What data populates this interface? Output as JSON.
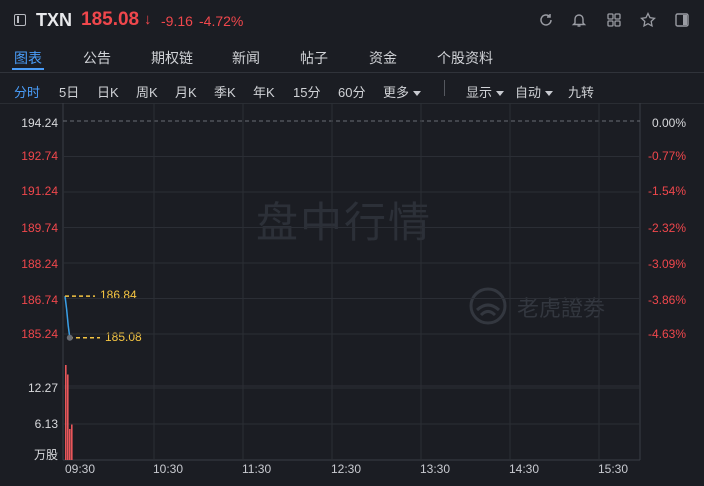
{
  "header": {
    "ticker": "TXN",
    "price": "185.08",
    "price_arrow": "↓",
    "change": "-9.16",
    "change_pct": "-4.72%",
    "icons": [
      "sidebar-toggle-icon",
      "refresh-icon",
      "bell-icon",
      "grid-icon",
      "star-icon",
      "panel-icon"
    ]
  },
  "tabs": [
    {
      "label": "图表",
      "active": true
    },
    {
      "label": "公告"
    },
    {
      "label": "期权链"
    },
    {
      "label": "新闻"
    },
    {
      "label": "帖子"
    },
    {
      "label": "资金"
    },
    {
      "label": "个股资料"
    }
  ],
  "periods": [
    {
      "label": "分时",
      "active": true
    },
    {
      "label": "5日"
    },
    {
      "label": "日K"
    },
    {
      "label": "周K"
    },
    {
      "label": "月K"
    },
    {
      "label": "季K"
    },
    {
      "label": "年K"
    },
    {
      "label": "15分"
    },
    {
      "label": "60分"
    },
    {
      "label": "更多"
    }
  ],
  "controls": [
    "显示",
    "自动",
    "九转"
  ],
  "watermark": "盘中行情",
  "brand": "老虎證劵",
  "colors": {
    "background": "#1b1d23",
    "accent": "#4a9df8",
    "down": "#f0474c",
    "tag": "#f5c542",
    "price_line": "#3aa0e8"
  },
  "chart_data": {
    "type": "line",
    "y_ticks": [
      "194.24",
      "192.74",
      "191.24",
      "189.74",
      "188.24",
      "186.74",
      "185.24"
    ],
    "y_pct_ticks": [
      "0.00%",
      "-0.77%",
      "-1.54%",
      "-2.32%",
      "-3.09%",
      "-3.86%",
      "-4.63%"
    ],
    "ylim": [
      185.24,
      194.24
    ],
    "prev_close": 194.24,
    "x_ticks": [
      "09:30",
      "10:30",
      "11:30",
      "12:30",
      "13:30",
      "14:30",
      "15:30"
    ],
    "series": [
      {
        "x": [
          "09:30",
          "09:31",
          "09:32",
          "09:33"
        ],
        "values": [
          186.84,
          186.3,
          185.6,
          185.08
        ]
      }
    ],
    "high_tag": "186.84",
    "last_tag": "185.08",
    "volume": {
      "unit": "万股",
      "y_ticks": [
        "12.27",
        "6.13"
      ],
      "ylim": [
        0,
        15
      ],
      "bars": [
        15.0,
        13.5,
        4.9,
        5.6
      ]
    }
  }
}
